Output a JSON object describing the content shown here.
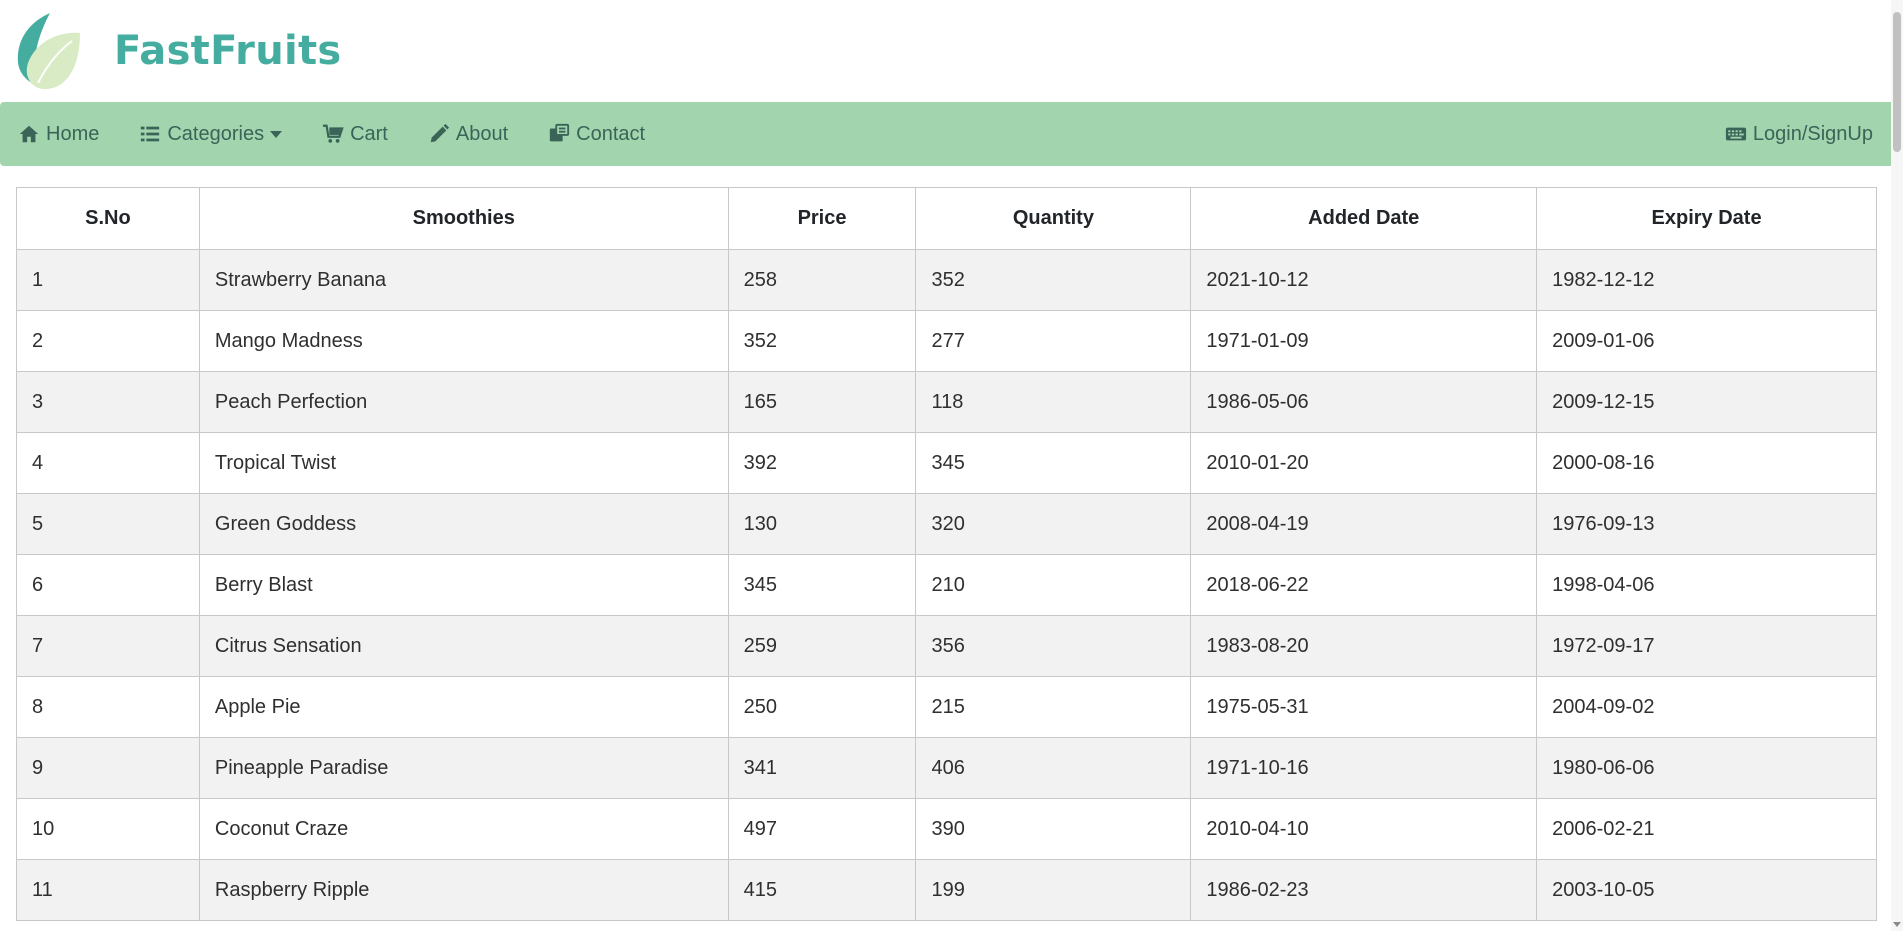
{
  "brand": {
    "name": "FastFruits"
  },
  "nav": {
    "home": "Home",
    "categories": "Categories",
    "cart": "Cart",
    "about": "About",
    "contact": "Contact",
    "login": "Login/SignUp"
  },
  "table": {
    "headers": [
      "S.No",
      "Smoothies",
      "Price",
      "Quantity",
      "Added Date",
      "Expiry Date"
    ],
    "rows": [
      [
        "1",
        "Strawberry Banana",
        "258",
        "352",
        "2021-10-12",
        "1982-12-12"
      ],
      [
        "2",
        "Mango Madness",
        "352",
        "277",
        "1971-01-09",
        "2009-01-06"
      ],
      [
        "3",
        "Peach Perfection",
        "165",
        "118",
        "1986-05-06",
        "2009-12-15"
      ],
      [
        "4",
        "Tropical Twist",
        "392",
        "345",
        "2010-01-20",
        "2000-08-16"
      ],
      [
        "5",
        "Green Goddess",
        "130",
        "320",
        "2008-04-19",
        "1976-09-13"
      ],
      [
        "6",
        "Berry Blast",
        "345",
        "210",
        "2018-06-22",
        "1998-04-06"
      ],
      [
        "7",
        "Citrus Sensation",
        "259",
        "356",
        "1983-08-20",
        "1972-09-17"
      ],
      [
        "8",
        "Apple Pie",
        "250",
        "215",
        "1975-05-31",
        "2004-09-02"
      ],
      [
        "9",
        "Pineapple Paradise",
        "341",
        "406",
        "1971-10-16",
        "1980-06-06"
      ],
      [
        "10",
        "Coconut Craze",
        "497",
        "390",
        "2010-04-10",
        "2006-02-21"
      ],
      [
        "11",
        "Raspberry Ripple",
        "415",
        "199",
        "1986-02-23",
        "2003-10-05"
      ]
    ]
  },
  "colors": {
    "brand": "#45ada0",
    "navbar": "#a2d5ae",
    "nav_text": "#3a6458",
    "row_stripe": "#f2f2f2"
  },
  "icons": {
    "home": "home-icon",
    "categories": "list-icon",
    "cart": "cart-icon",
    "about": "pencil-icon",
    "contact": "contact-icon",
    "login": "keyboard-icon"
  }
}
